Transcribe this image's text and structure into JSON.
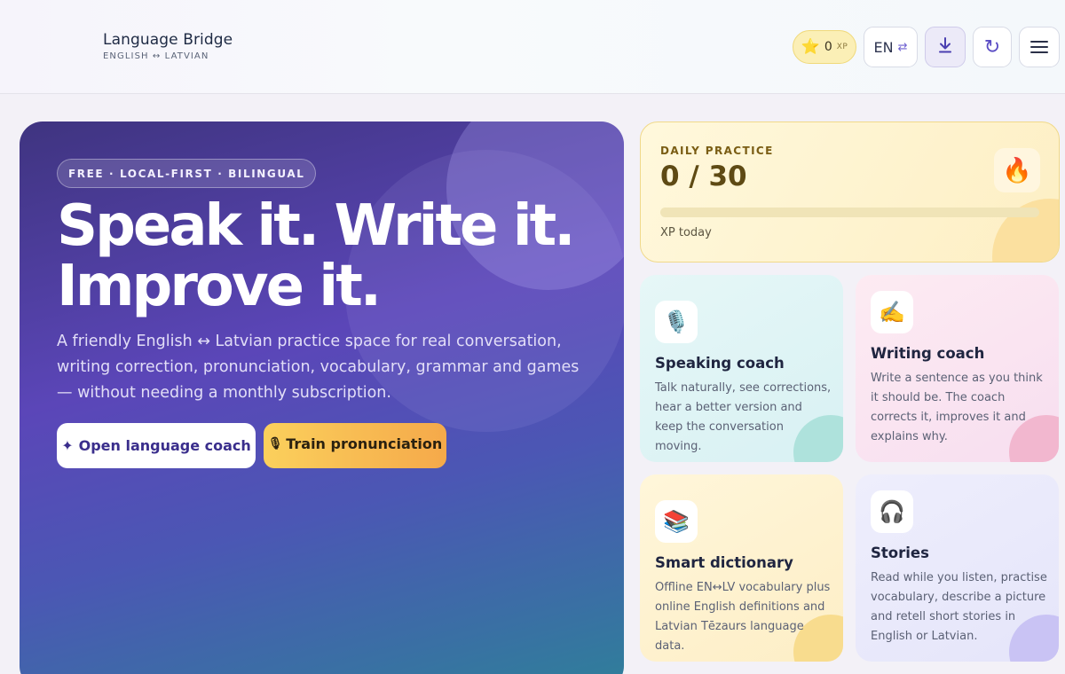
{
  "header": {
    "title": "Language Bridge",
    "subtitle": "ENGLISH ↔ LATVIAN",
    "xp_value": "0",
    "xp_unit": "XP",
    "lang_label": "EN",
    "lang_swap_icon": "⇄",
    "refresh_icon": "↻",
    "star_icon": "⭐"
  },
  "hero": {
    "badge": "FREE · LOCAL-FIRST · BILINGUAL",
    "title_line1": "Speak it. Write it.",
    "title_line2": "Improve it.",
    "description": "A friendly English ↔ Latvian practice space for real conversation, writing correction, pronunciation, vocabulary, grammar and games — without needing a monthly subscription.",
    "primary_icon": "✦",
    "primary_button": "Open language coach",
    "secondary_icon": "🎙",
    "secondary_button": "Train pronunciation"
  },
  "daily": {
    "label": "DAILY PRACTICE",
    "count": "0 / 30",
    "progress": 0,
    "caption": "XP today",
    "icon": "🔥"
  },
  "cards": [
    {
      "icon": "🎙️",
      "title": "Speaking coach",
      "description": "Talk naturally, see corrections, hear a better version and keep the conversation moving."
    },
    {
      "icon": "✍️",
      "title": "Writing coach",
      "description": "Write a sentence as you think it should be. The coach corrects it, improves it and explains why."
    },
    {
      "icon": "📚",
      "title": "Smart dictionary",
      "description": "Offline EN↔LV vocabulary plus online English definitions and Latvian Tēzaurs language data."
    },
    {
      "icon": "🎧",
      "title": "Stories",
      "description": "Read while you listen, practise vocabulary, describe a picture and retell short stories in English or Latvian."
    }
  ],
  "colors": {
    "accent": "#5b46b8",
    "hero_gradient_end": "#2f7f9a",
    "pronunciation_button": "#f5a94a"
  }
}
